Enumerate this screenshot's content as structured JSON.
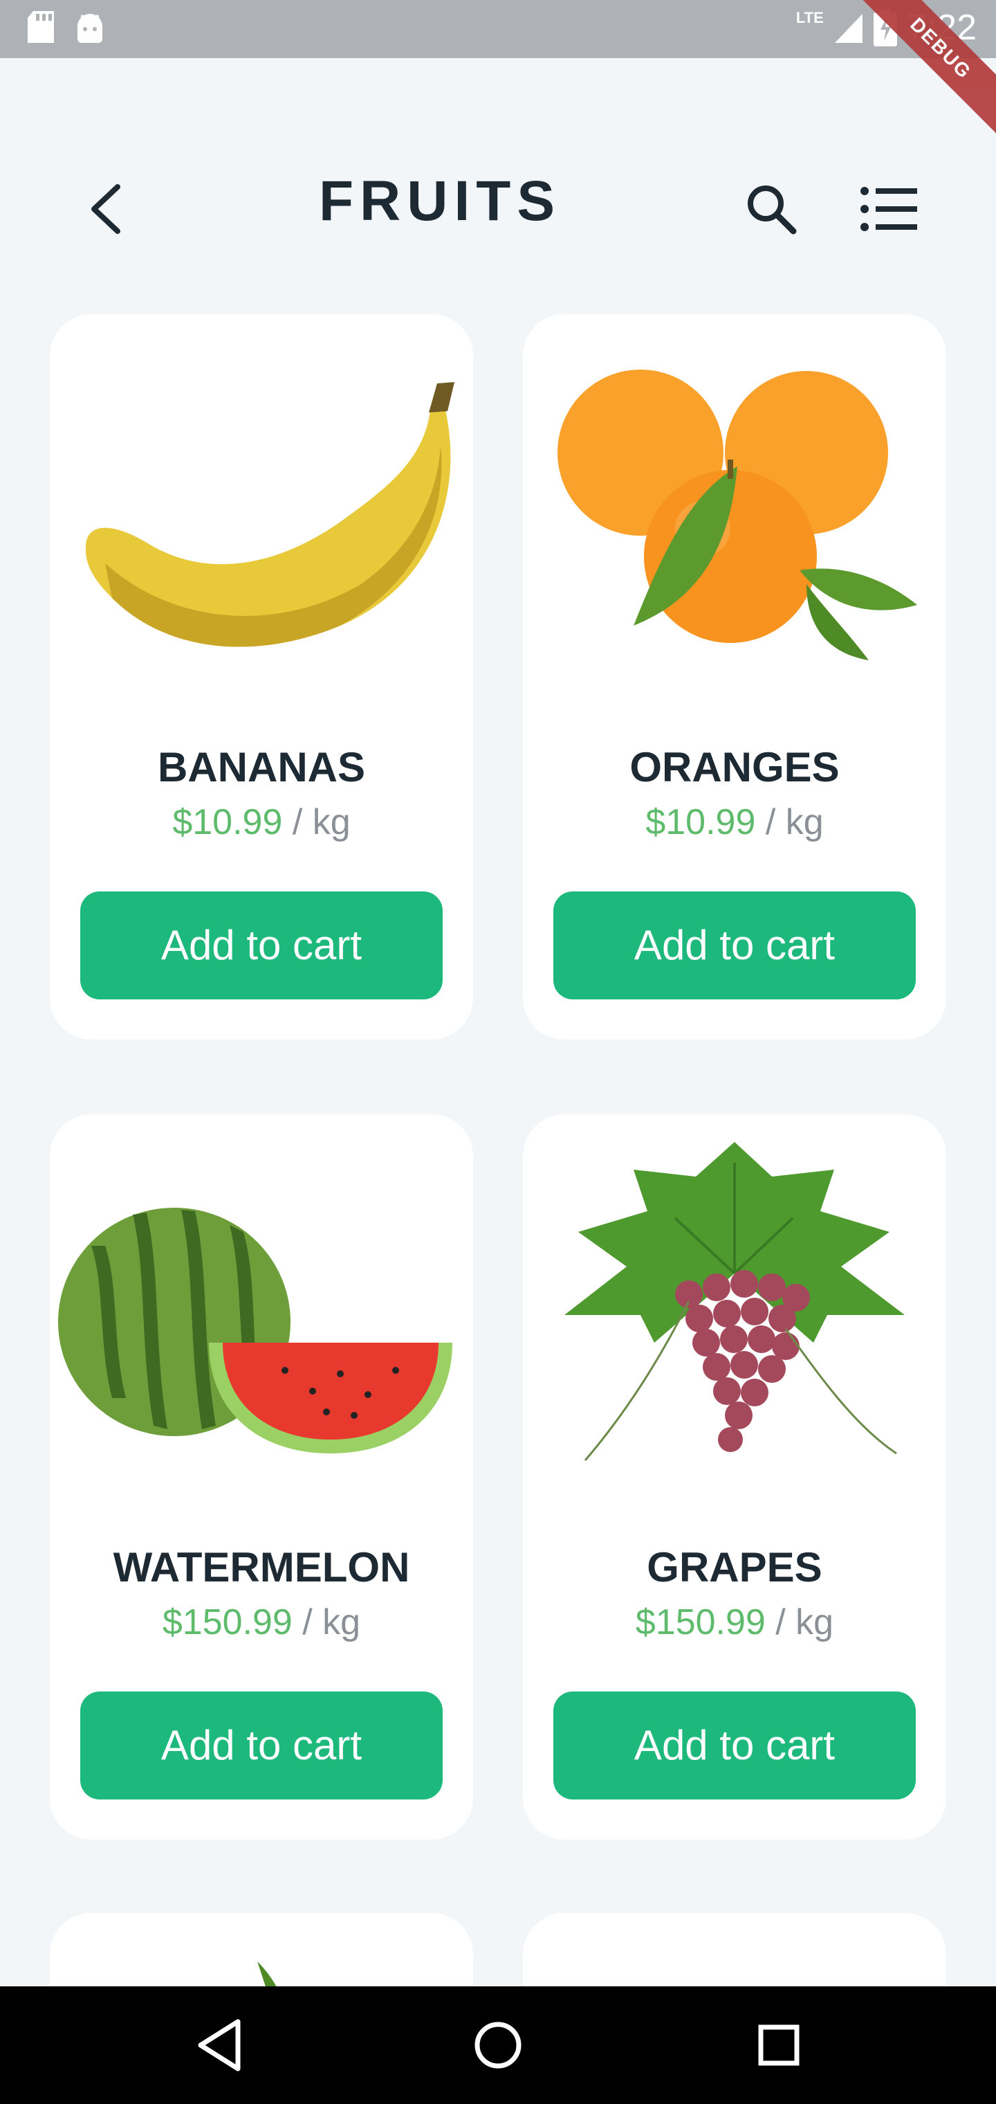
{
  "status_bar": {
    "time": "7:22",
    "network": "LTE",
    "debug_banner": "DEBUG"
  },
  "header": {
    "title": "FRUITS",
    "back_icon": "chevron-left-icon",
    "search_icon": "search-icon",
    "menu_icon": "list-icon"
  },
  "products": [
    {
      "name": "BANANAS",
      "price": "$10.99",
      "unit": " / kg",
      "button": "Add to cart",
      "image": "banana"
    },
    {
      "name": "ORANGES",
      "price": "$10.99",
      "unit": " / kg",
      "button": "Add to cart",
      "image": "oranges"
    },
    {
      "name": "WATERMELON",
      "price": "$150.99",
      "unit": " / kg",
      "button": "Add to cart",
      "image": "watermelon"
    },
    {
      "name": "GRAPES",
      "price": "$150.99",
      "unit": " / kg",
      "button": "Add to cart",
      "image": "grapes"
    }
  ],
  "colors": {
    "accent": "#1DB87C",
    "price": "#5DBB6B",
    "title": "#1E2A33",
    "background": "#F3F6F8"
  }
}
